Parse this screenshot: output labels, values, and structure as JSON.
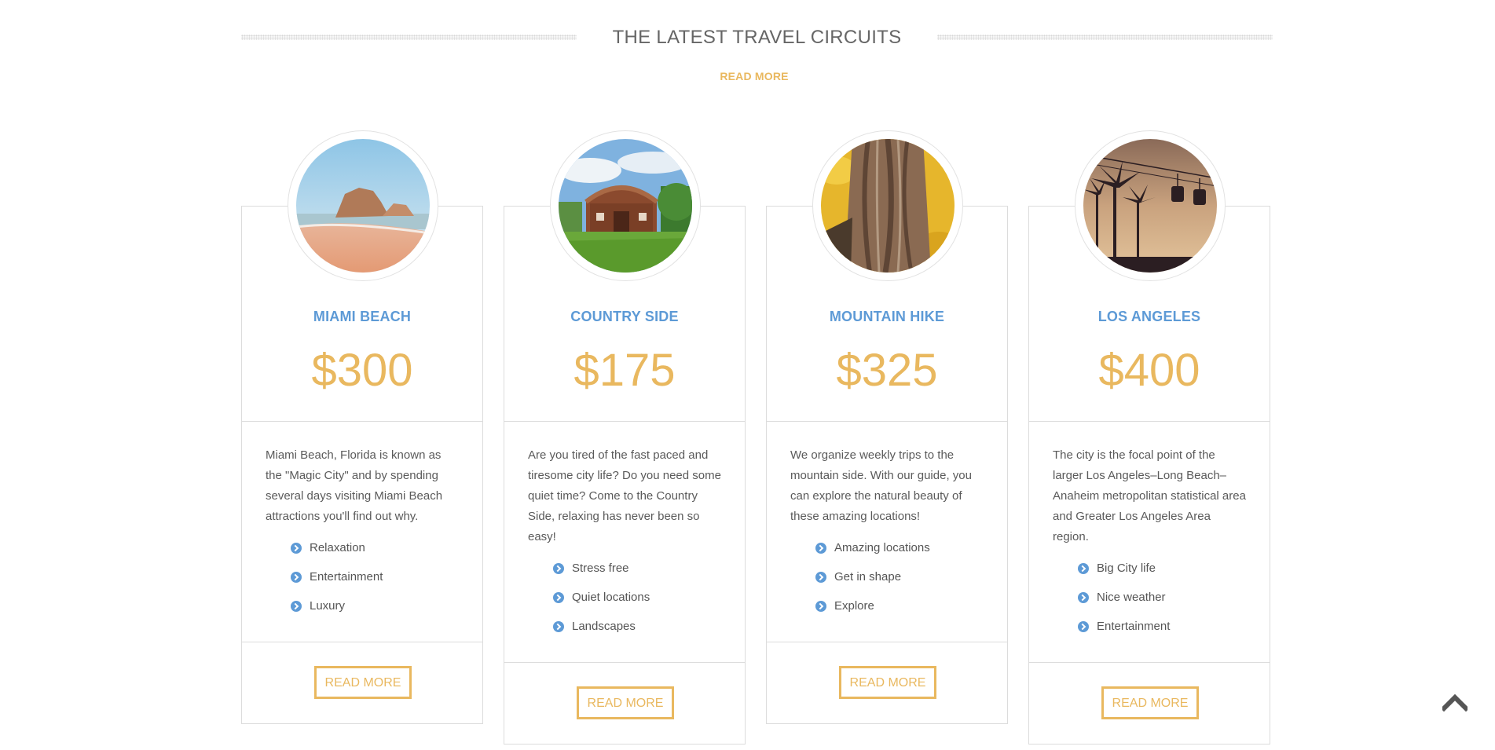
{
  "section": {
    "title": "THE LATEST TRAVEL CIRCUITS",
    "link_label": "READ MORE"
  },
  "cards": [
    {
      "title": "MIAMI BEACH",
      "price": "$300",
      "description": "Miami Beach, Florida is known as the \"Magic City\" and by spending several days visiting Miami Beach attractions you'll find out why.",
      "features": [
        "Relaxation",
        "Entertainment",
        "Luxury"
      ],
      "button": "READ MORE",
      "image": "beach-photo"
    },
    {
      "title": "COUNTRY SIDE",
      "price": "$175",
      "description": "Are you tired of the fast paced and tiresome city life? Do you need some quiet time? Come to the Country Side, relaxing has never been so easy!",
      "features": [
        "Stress free",
        "Quiet locations",
        "Landscapes"
      ],
      "button": "READ MORE",
      "image": "barn-photo"
    },
    {
      "title": "MOUNTAIN HIKE",
      "price": "$325",
      "description": "We organize weekly trips to the mountain side. With our guide, you can explore the natural beauty of these amazing locations!",
      "features": [
        "Amazing locations",
        "Get in shape",
        "Explore"
      ],
      "button": "READ MORE",
      "image": "tree-bark-photo"
    },
    {
      "title": "LOS ANGELES",
      "price": "$400",
      "description": "The city is the focal point of the larger Los Angeles–Long Beach–Anaheim metropolitan statistical area and Greater Los Angeles Area region.",
      "features": [
        "Big City life",
        "Nice weather",
        "Entertainment"
      ],
      "button": "READ MORE",
      "image": "palm-trees-gondola-photo"
    }
  ],
  "colors": {
    "accent_gold": "#e9b85f",
    "accent_blue": "#5d9ad6",
    "border": "#dcdcdc",
    "text": "#5a5a5a"
  },
  "scroll_top_icon": "chevron-up-icon"
}
